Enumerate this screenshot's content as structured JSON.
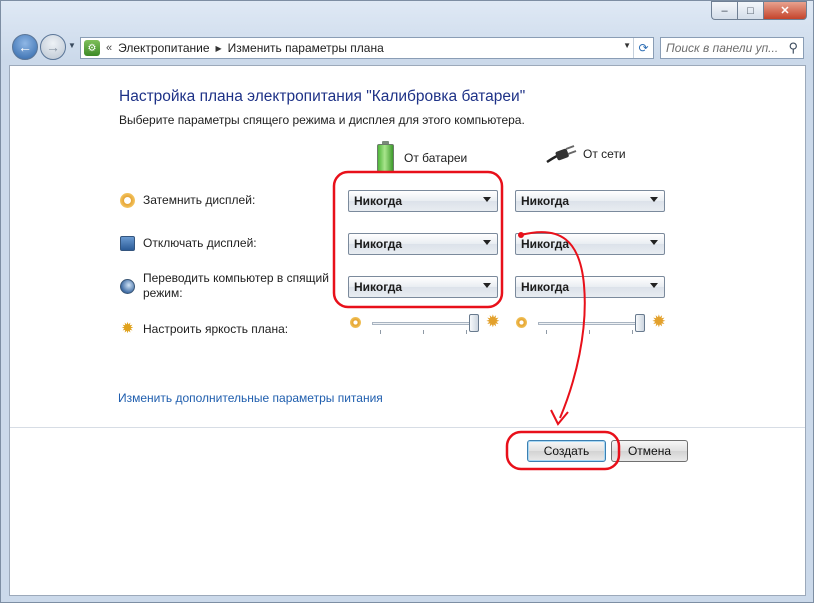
{
  "window": {
    "minimize_glyph": "–",
    "maximize_glyph": "□",
    "close_glyph": "✕"
  },
  "nav": {
    "back_glyph": "←",
    "forward_glyph": "→",
    "breadcrumb_root": "Электропитание",
    "breadcrumb_current": "Изменить параметры плана",
    "search_placeholder": "Поиск в панели уп..."
  },
  "page": {
    "title": "Настройка плана электропитания \"Калибровка батареи\"",
    "subtitle": "Выберите параметры спящего режима и дисплея для этого компьютера.",
    "col_battery": "От батареи",
    "col_ac": "От сети",
    "rows": [
      {
        "label": "Затемнить дисплей:",
        "battery": "Никогда",
        "ac": "Никогда",
        "icon": "dim-display-icon"
      },
      {
        "label": "Отключать дисплей:",
        "battery": "Никогда",
        "ac": "Никогда",
        "icon": "display-off-icon"
      },
      {
        "label": "Переводить компьютер в спящий режим:",
        "battery": "Никогда",
        "ac": "Никогда",
        "icon": "sleep-icon"
      }
    ],
    "brightness_label": "Настроить яркость плана:",
    "brightness": {
      "battery_level": 1.0,
      "ac_level": 1.0
    },
    "advanced_link": "Изменить дополнительные параметры питания",
    "create_button": "Создать",
    "cancel_button": "Отмена"
  },
  "colors": {
    "title": "#1e3287",
    "link": "#1f5eae",
    "annotation": "#e8101a"
  }
}
